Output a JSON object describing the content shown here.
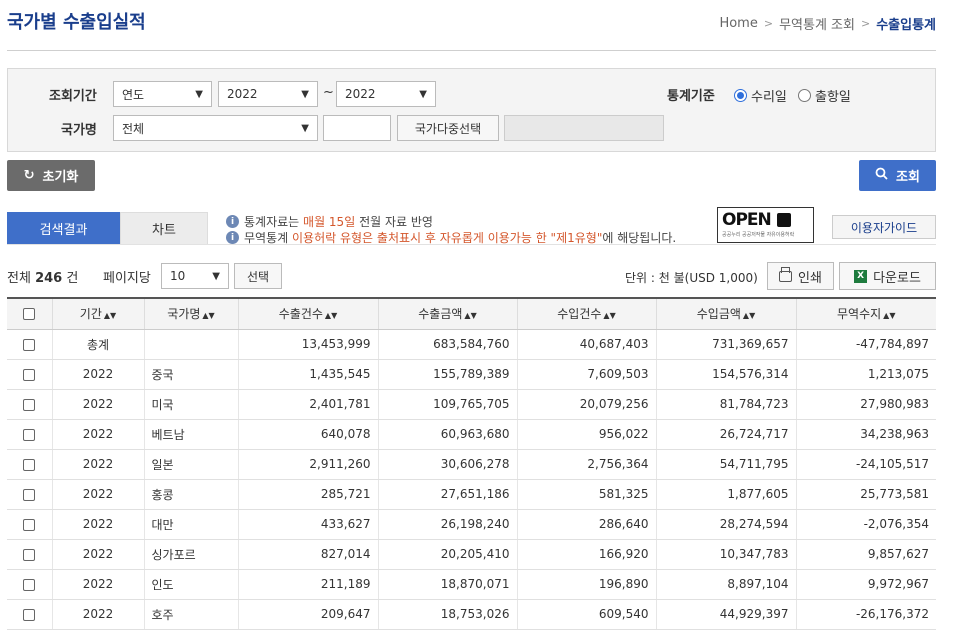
{
  "page_title": "국가별 수출입실적",
  "breadcrumb": [
    "Home",
    "무역통계 조회",
    "수출입통계"
  ],
  "search": {
    "period_label": "조회기간",
    "period_unit": "연도",
    "year_from": "2022",
    "tilde": "~",
    "year_to": "2022",
    "basis_label": "통계기준",
    "basis_options": [
      "수리일",
      "출항일"
    ],
    "country_label": "국가명",
    "country_value": "전체",
    "multi_select_label": "국가다중선택"
  },
  "buttons": {
    "reset": "초기화",
    "search": "조회",
    "guide": "이용자가이드",
    "select": "선택",
    "print": "인쇄",
    "download": "다운로드"
  },
  "tabs": [
    "검색결과",
    "차트"
  ],
  "notices": {
    "line1_a": "통계자료는",
    "line1_hl": "매월 15일",
    "line1_b": "전월 자료 반영",
    "line2_a": "무역통계",
    "line2_hl": "이용허락 유형은 출처표시 후 자유롭게 이용가능 한 \"제1유형\"",
    "line2_b": "에 해당됩니다."
  },
  "open_logo": {
    "title": "OPEN",
    "sub": "공공누리  공공저작물 자유이용허락"
  },
  "summary": {
    "total_prefix": "전체",
    "total_count": "246",
    "total_suffix": "건",
    "per_page_label": "페이지당",
    "per_page": "10",
    "unit": "단위 : 천 불(USD 1,000)"
  },
  "table": {
    "headers": [
      "기간",
      "국가명",
      "수출건수",
      "수출금액",
      "수입건수",
      "수입금액",
      "무역수지"
    ],
    "rows": [
      [
        "총계",
        "",
        "13,453,999",
        "683,584,760",
        "40,687,403",
        "731,369,657",
        "-47,784,897"
      ],
      [
        "2022",
        "중국",
        "1,435,545",
        "155,789,389",
        "7,609,503",
        "154,576,314",
        "1,213,075"
      ],
      [
        "2022",
        "미국",
        "2,401,781",
        "109,765,705",
        "20,079,256",
        "81,784,723",
        "27,980,983"
      ],
      [
        "2022",
        "베트남",
        "640,078",
        "60,963,680",
        "956,022",
        "26,724,717",
        "34,238,963"
      ],
      [
        "2022",
        "일본",
        "2,911,260",
        "30,606,278",
        "2,756,364",
        "54,711,795",
        "-24,105,517"
      ],
      [
        "2022",
        "홍콩",
        "285,721",
        "27,651,186",
        "581,325",
        "1,877,605",
        "25,773,581"
      ],
      [
        "2022",
        "대만",
        "433,627",
        "26,198,240",
        "286,640",
        "28,274,594",
        "-2,076,354"
      ],
      [
        "2022",
        "싱가포르",
        "827,014",
        "20,205,410",
        "166,920",
        "10,347,783",
        "9,857,627"
      ],
      [
        "2022",
        "인도",
        "211,189",
        "18,870,071",
        "196,890",
        "8,897,104",
        "9,972,967"
      ],
      [
        "2022",
        "호주",
        "209,647",
        "18,753,026",
        "609,540",
        "44,929,397",
        "-26,176,372"
      ]
    ]
  }
}
